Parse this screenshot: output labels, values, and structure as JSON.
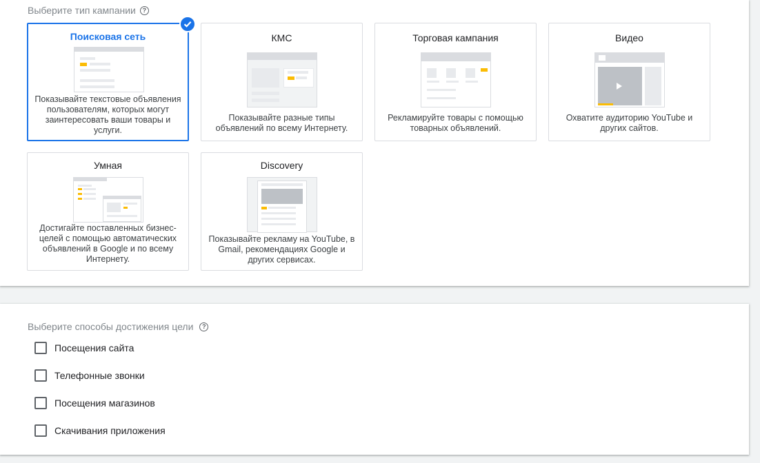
{
  "campaign_type": {
    "title": "Выберите тип кампании",
    "cards": [
      {
        "title": "Поисковая сеть",
        "desc": "Показывайте текстовые объявления пользователям, которых могут заинтересовать ваши товары и услуги."
      },
      {
        "title": "КМС",
        "desc": "Показывайте разные типы объявлений по всему Интернету."
      },
      {
        "title": "Торговая кампания",
        "desc": "Рекламируйте товары с помощью товарных объявлений."
      },
      {
        "title": "Видео",
        "desc": "Охватите аудиторию YouTube и других сайтов."
      },
      {
        "title": "Умная",
        "desc": "Достигайте поставленных бизнес-целей с помощью автоматических объявлений в Google и по всему Интернету."
      },
      {
        "title": "Discovery",
        "desc": "Показывайте рекламу на YouTube, в Gmail, рекомендациях Google и других сервисах."
      }
    ]
  },
  "goals": {
    "title": "Выберите способы достижения цели",
    "options": [
      {
        "label": "Посещения сайта"
      },
      {
        "label": "Телефонные звонки"
      },
      {
        "label": "Посещения магазинов"
      },
      {
        "label": "Скачивания приложения"
      }
    ]
  },
  "colors": {
    "accent": "#1a73e8",
    "highlight": "#fbbc04"
  }
}
